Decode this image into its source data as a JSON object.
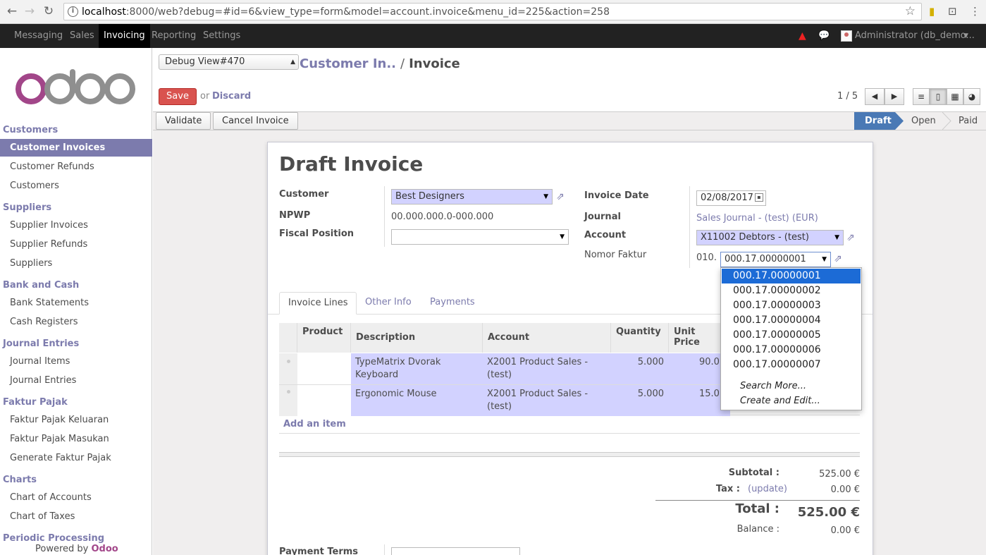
{
  "browser": {
    "url_host": "localhost",
    "url_path": ":8000/web?debug=#id=6&view_type=form&model=account.invoice&menu_id=225&action=258"
  },
  "topbar": {
    "menus": [
      "Messaging",
      "Sales",
      "Invoicing",
      "Reporting",
      "Settings"
    ],
    "active_menu": "Invoicing",
    "user": "Administrator (db_demo..."
  },
  "sidebar": {
    "sections": [
      {
        "title": "Customers",
        "items": [
          "Customer Invoices",
          "Customer Refunds",
          "Customers"
        ]
      },
      {
        "title": "Suppliers",
        "items": [
          "Supplier Invoices",
          "Supplier Refunds",
          "Suppliers"
        ]
      },
      {
        "title": "Bank and Cash",
        "items": [
          "Bank Statements",
          "Cash Registers"
        ]
      },
      {
        "title": "Journal Entries",
        "items": [
          "Journal Items",
          "Journal Entries"
        ]
      },
      {
        "title": "Faktur Pajak",
        "items": [
          "Faktur Pajak Keluaran",
          "Faktur Pajak Masukan",
          "Generate Faktur Pajak"
        ]
      },
      {
        "title": "Charts",
        "items": [
          "Chart of Accounts",
          "Chart of Taxes"
        ]
      },
      {
        "title": "Periodic Processing",
        "items": []
      }
    ],
    "active_item": "Customer Invoices",
    "powered_prefix": "Powered by",
    "powered_brand": "Odoo"
  },
  "control": {
    "debug_view": "Debug View#470",
    "breadcrumb_parent": "Customer In..",
    "breadcrumb_sep": "/",
    "breadcrumb_current": "Invoice",
    "save": "Save",
    "or": "or",
    "discard": "Discard",
    "pager": "1 / 5"
  },
  "statusbar": {
    "buttons": [
      "Validate",
      "Cancel Invoice"
    ],
    "stages": [
      "Draft",
      "Open",
      "Paid"
    ],
    "active_stage": "Draft"
  },
  "form": {
    "title": "Draft Invoice",
    "customer_label": "Customer",
    "customer_value": "Best Designers",
    "npwp_label": "NPWP",
    "npwp_value": "00.000.000.0-000.000",
    "fiscal_label": "Fiscal Position",
    "fiscal_value": "",
    "invoice_date_label": "Invoice Date",
    "invoice_date_value": "02/08/2017",
    "journal_label": "Journal",
    "journal_value": "Sales Journal - (test) (EUR)",
    "account_label": "Account",
    "account_value": "X11002 Debtors - (test)",
    "nomor_label": "Nomor Faktur",
    "nomor_prefix": "010.",
    "nomor_value": "000.17.00000001"
  },
  "tabs": [
    "Invoice Lines",
    "Other Info",
    "Payments"
  ],
  "lines": {
    "headers": [
      "Product",
      "Description",
      "Account",
      "Quantity",
      "Unit Price"
    ],
    "rows": [
      {
        "product": "",
        "description": "TypeMatrix Dvorak Keyboard",
        "account": "X2001 Product Sales - (test)",
        "quantity": "5.000",
        "unit_price": "90.0"
      },
      {
        "product": "",
        "description": "Ergonomic Mouse",
        "account": "X2001 Product Sales - (test)",
        "quantity": "5.000",
        "unit_price": "15.0"
      }
    ],
    "add_item": "Add an item"
  },
  "totals": {
    "subtotal_label": "Subtotal :",
    "subtotal_value": "525.00 €",
    "tax_label": "Tax :",
    "tax_update": "(update)",
    "tax_value": "0.00 €",
    "total_label": "Total :",
    "total_value": "525.00 €",
    "balance_label": "Balance :",
    "balance_value": "0.00 €"
  },
  "payment_terms_label": "Payment Terms",
  "dropdown": {
    "options": [
      "000.17.00000001",
      "000.17.00000002",
      "000.17.00000003",
      "000.17.00000004",
      "000.17.00000005",
      "000.17.00000006",
      "000.17.00000007"
    ],
    "selected": "000.17.00000001",
    "search_more": "Search More...",
    "create_edit": "Create and Edit..."
  }
}
